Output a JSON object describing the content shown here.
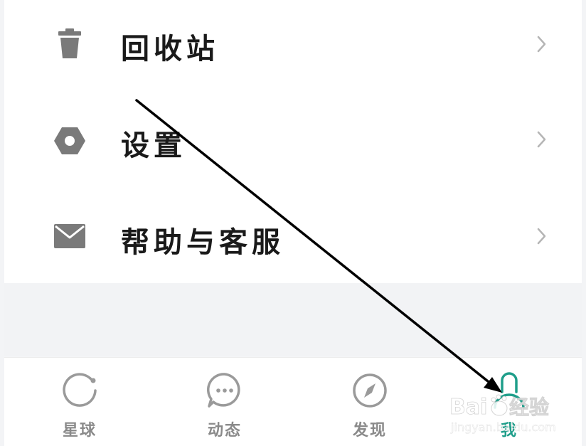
{
  "menu": {
    "items": [
      {
        "label": "回收站",
        "icon": "trash-icon"
      },
      {
        "label": "设置",
        "icon": "gear-icon"
      },
      {
        "label": "帮助与客服",
        "icon": "mail-icon"
      }
    ]
  },
  "tabbar": {
    "tabs": [
      {
        "label": "星球",
        "icon": "planet-icon",
        "active": false
      },
      {
        "label": "动态",
        "icon": "chat-icon",
        "active": false
      },
      {
        "label": "发现",
        "icon": "compass-icon",
        "active": false
      },
      {
        "label": "我",
        "icon": "person-icon",
        "active": true
      }
    ]
  },
  "colors": {
    "accent": "#1e9e8a",
    "icon_gray": "#7a7a7a",
    "tab_gray": "#8a8a8a",
    "annotation_arrow": "#000000"
  },
  "watermark": {
    "brand": "Baidu",
    "suffix": "经验",
    "url": "jingyan.baidu.com"
  }
}
